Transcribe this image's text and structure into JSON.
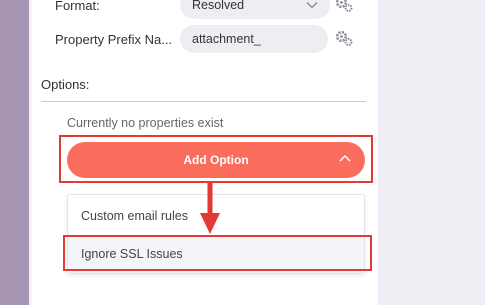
{
  "form": {
    "format": {
      "label": "Format:",
      "value": "Resolved"
    },
    "prefix": {
      "label": "Property Prefix Na...",
      "value": "attachment_"
    }
  },
  "options": {
    "section_label": "Options:",
    "empty_text": "Currently no properties exist",
    "add_button_label": "Add Option",
    "menu_items": [
      "Custom email rules",
      "Ignore SSL Issues"
    ]
  },
  "colors": {
    "accent": "#fa6c5c",
    "annotation": "#e53935",
    "sidebar": "#a696b3"
  },
  "icons": [
    "gear-icon",
    "chevron-down-icon",
    "chevron-up-icon",
    "arrow-down-icon"
  ]
}
